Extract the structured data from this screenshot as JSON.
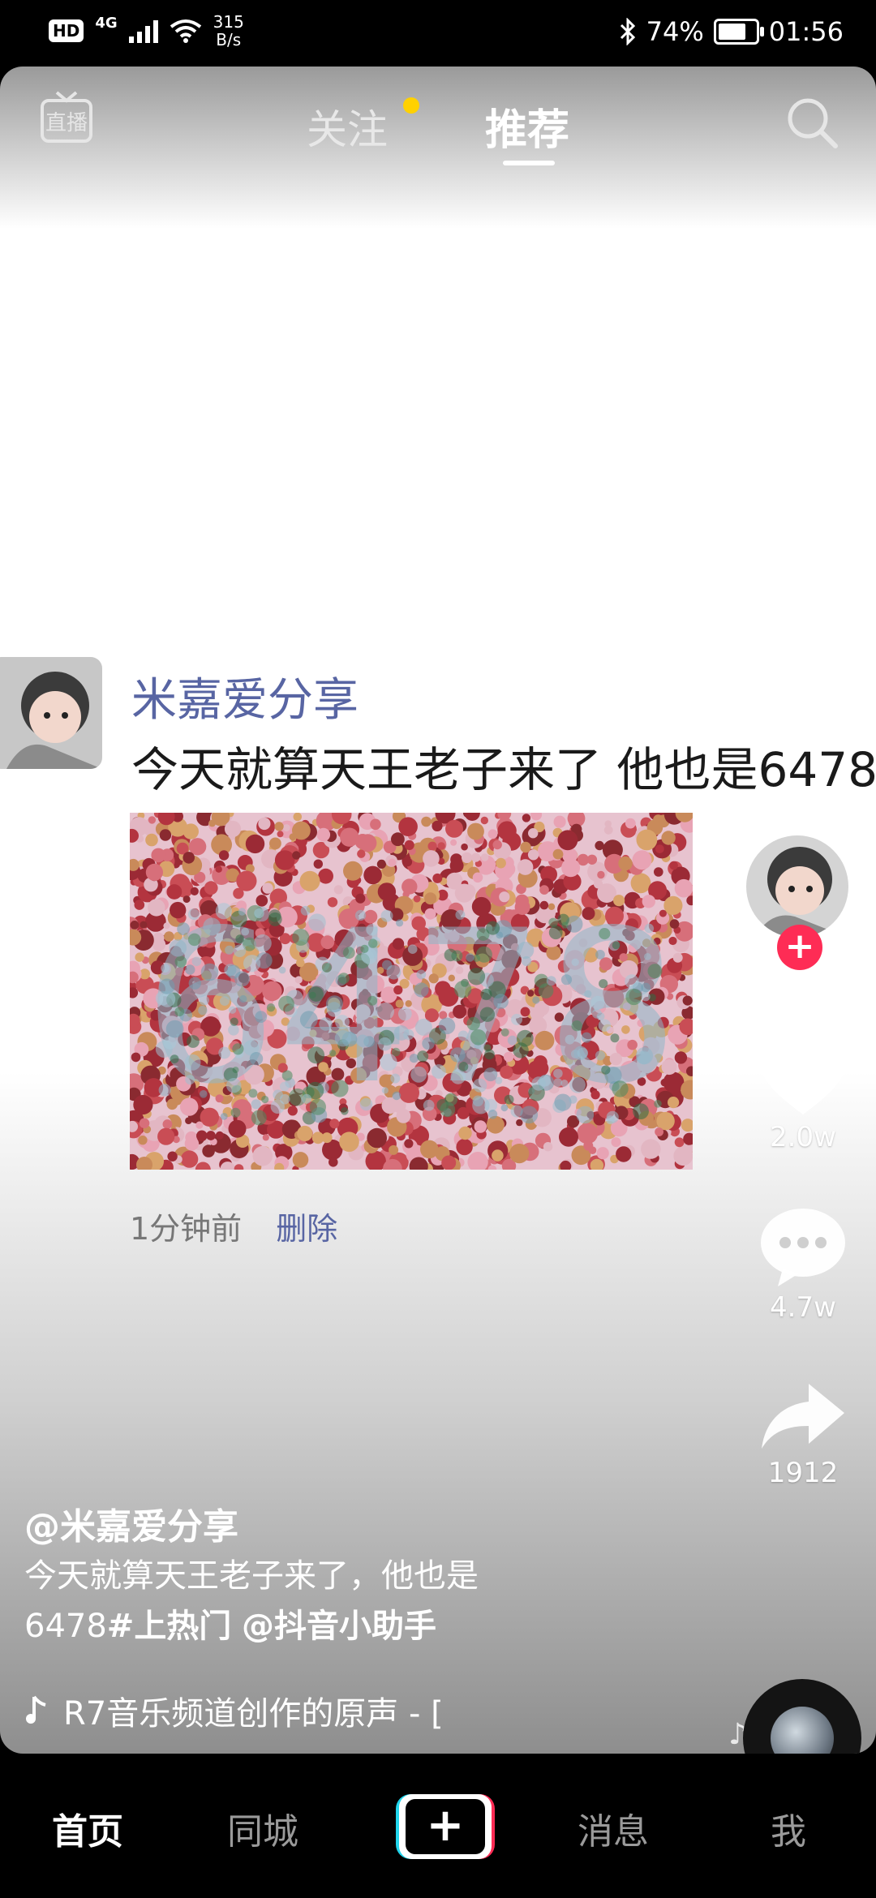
{
  "status_bar": {
    "hd": "HD",
    "network": "4G",
    "speed_top": "315",
    "speed_bottom": "B/s",
    "battery_percent": "74%",
    "battery_level": 0.74,
    "time": "01:56"
  },
  "top_nav": {
    "live_icon": "live-tv-icon",
    "live_label": "直播",
    "follow_tab": "关注",
    "recommend_tab": "推荐",
    "search_icon": "search-icon"
  },
  "post": {
    "username": "米嘉爱分享",
    "text": "今天就算天王老子来了  他也是6478",
    "image_number": "6478",
    "time_ago": "1分钟前",
    "delete_label": "删除"
  },
  "right_rail": {
    "likes": "2.0w",
    "comments": "4.7w",
    "shares": "1912",
    "follow_plus": "+"
  },
  "caption": {
    "author": "@米嘉爱分享",
    "line1": "今天就算天王老子来了，他也是",
    "line2_prefix": "6478",
    "hashtag": "#上热门",
    "mention": "@抖音小助手"
  },
  "music": {
    "icon": "music-note-icon",
    "title": "R7音乐频道创作的原声 - [",
    "floating_note": "♪"
  },
  "tab_bar": {
    "home": "首页",
    "nearby": "同城",
    "create": "+",
    "messages": "消息",
    "me": "我"
  },
  "colors": {
    "accent_red": "#fe2c55",
    "accent_cyan": "#20d5ec",
    "notif_dot": "#ffd100",
    "link_blue": "#5865a3"
  }
}
